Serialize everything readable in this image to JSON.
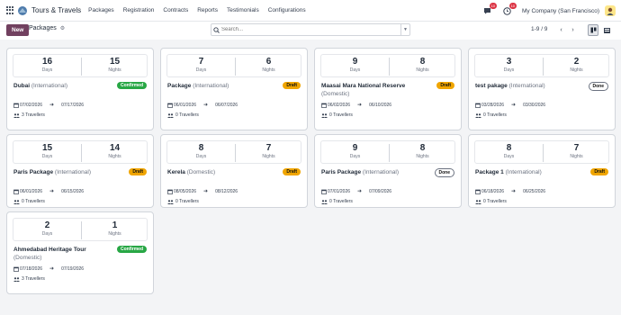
{
  "topbar": {
    "app_name": "Tours & Travels",
    "menu": [
      "Packages",
      "Registration",
      "Contracts",
      "Reports",
      "Testimonials",
      "Configurations"
    ],
    "chat_count": "10",
    "activity_count": "10",
    "company": "My Company (San Francisco)"
  },
  "control": {
    "new_label": "New",
    "title": "Packages",
    "search_placeholder": "Search...",
    "pager": "1-9 / 9"
  },
  "labels": {
    "days": "Days",
    "nights": "Nights"
  },
  "colors": {
    "brand": "#71405f",
    "draft": "#f0a500",
    "confirmed": "#28a745"
  },
  "cards": [
    {
      "days": "16",
      "nights": "15",
      "name": "Dubai",
      "category": "(International)",
      "status": "Confirmed",
      "status_type": "confirmed",
      "start": "07/02/2026",
      "end": "07/17/2026",
      "travellers": "3 Travellers"
    },
    {
      "days": "7",
      "nights": "6",
      "name": "Package",
      "category": "(International)",
      "status": "Draft",
      "status_type": "draft",
      "start": "06/01/2026",
      "end": "06/07/2026",
      "travellers": "0 Travellers"
    },
    {
      "days": "9",
      "nights": "8",
      "name": "Maasai Mara National Reserve",
      "category": "(Domestic)",
      "status": "Draft",
      "status_type": "draft",
      "start": "06/02/2026",
      "end": "06/10/2026",
      "travellers": "0 Travellers"
    },
    {
      "days": "3",
      "nights": "2",
      "name": "test pakage",
      "category": "(International)",
      "status": "Done",
      "status_type": "done",
      "start": "03/28/2026",
      "end": "03/30/2026",
      "travellers": "0 Travellers"
    },
    {
      "days": "15",
      "nights": "14",
      "name": "Paris Package",
      "category": "(International)",
      "status": "Draft",
      "status_type": "draft",
      "start": "06/01/2026",
      "end": "06/15/2026",
      "travellers": "0 Travellers"
    },
    {
      "days": "8",
      "nights": "7",
      "name": "Kerela",
      "category": "(Domestic)",
      "status": "Draft",
      "status_type": "draft",
      "start": "08/05/2026",
      "end": "08/12/2026",
      "travellers": "0 Travellers"
    },
    {
      "days": "9",
      "nights": "8",
      "name": "Paris Package",
      "category": "(International)",
      "status": "Done",
      "status_type": "done",
      "start": "07/01/2026",
      "end": "07/09/2026",
      "travellers": "0 Travellers"
    },
    {
      "days": "8",
      "nights": "7",
      "name": "Package 1",
      "category": "(International)",
      "status": "Draft",
      "status_type": "draft",
      "start": "06/18/2026",
      "end": "06/25/2026",
      "travellers": "0 Travellers"
    },
    {
      "days": "2",
      "nights": "1",
      "name": "Ahmedabad Heritage Tour",
      "category": "(Domestic)",
      "status": "Confirmed",
      "status_type": "confirmed",
      "start": "07/18/2026",
      "end": "07/19/2026",
      "travellers": "3 Travellers"
    }
  ]
}
